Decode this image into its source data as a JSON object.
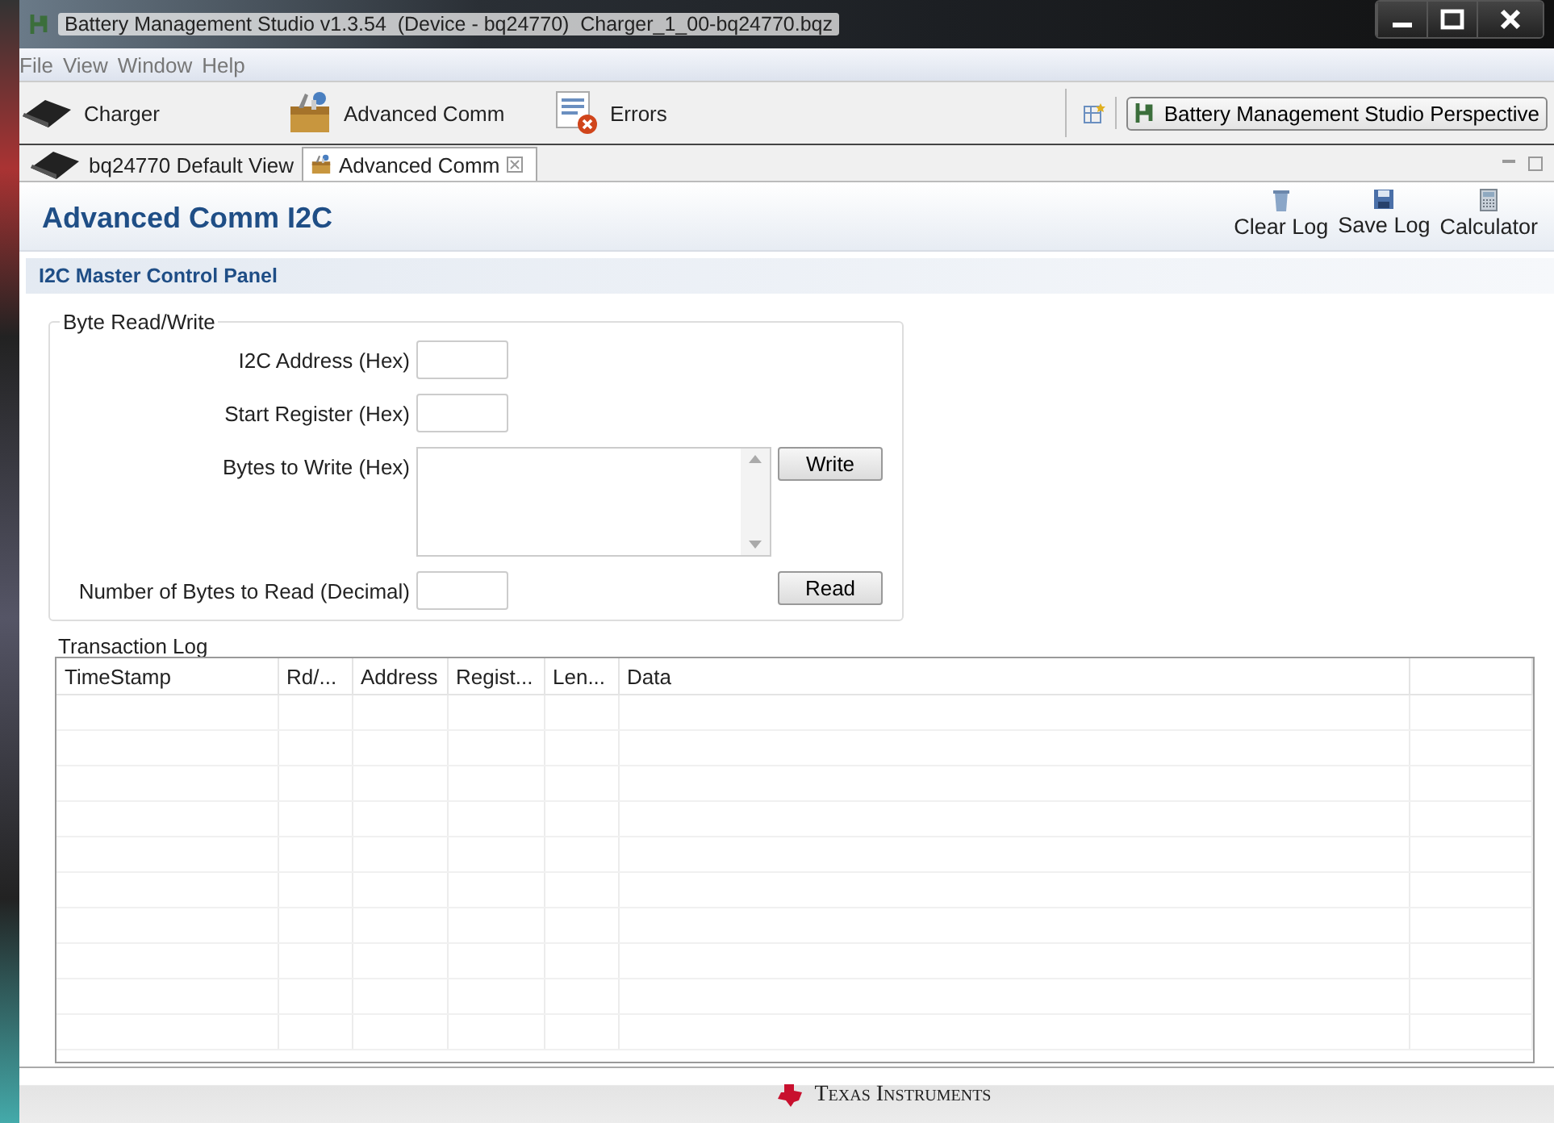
{
  "window": {
    "title": "Battery Management Studio v1.3.54  (Device - bq24770)  Charger_1_00-bq24770.bqz"
  },
  "menu": [
    "File",
    "View",
    "Window",
    "Help"
  ],
  "toolbar": {
    "items": [
      {
        "label": "Charger",
        "kind": "chip"
      },
      {
        "label": "Advanced Comm",
        "kind": "toolbox"
      },
      {
        "label": "Errors",
        "kind": "errors"
      }
    ],
    "perspective": "Battery Management Studio Perspective"
  },
  "tabs": [
    {
      "label": "bq24770 Default View",
      "selected": false,
      "kind": "chip"
    },
    {
      "label": "Advanced Comm",
      "selected": true,
      "kind": "toolbox"
    }
  ],
  "view": {
    "title": "Advanced Comm I2C",
    "actions": [
      {
        "label": "Clear Log",
        "kind": "clear"
      },
      {
        "label": "Save Log",
        "kind": "save"
      },
      {
        "label": "Calculator",
        "kind": "calc"
      }
    ]
  },
  "panel": {
    "title": "I2C Master Control Panel",
    "group": "Byte Read/Write",
    "fields": [
      {
        "label": "I2C Address (Hex)",
        "kind": "text"
      },
      {
        "label": "Start Register (Hex)",
        "kind": "text"
      },
      {
        "label": "Bytes to Write (Hex)",
        "kind": "area",
        "button": "Write"
      },
      {
        "label": "Number of Bytes to Read (Decimal)",
        "kind": "text",
        "button": "Read"
      }
    ]
  },
  "log": {
    "title": "Transaction Log",
    "columns": [
      "TimeStamp",
      "Rd/...",
      "Address",
      "Regist...",
      "Len...",
      "Data"
    ]
  },
  "footer": {
    "brand": "Texas Instruments"
  }
}
